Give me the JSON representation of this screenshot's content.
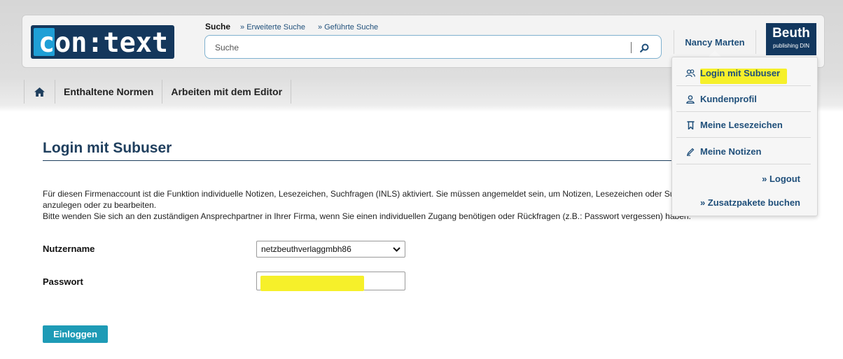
{
  "header": {
    "logo_text": "con:text",
    "search_title": "Suche",
    "search_links": [
      "» Erweiterte Suche",
      "» Geführte Suche"
    ],
    "search_placeholder": "Suche",
    "user_name": "Nancy Marten",
    "publisher_logo": {
      "name": "Beuth",
      "sub": "publishing DIN"
    }
  },
  "nav": {
    "items": [
      "Enthaltene Normen",
      "Arbeiten mit dem Editor"
    ]
  },
  "user_menu": {
    "items": [
      {
        "label": "Login mit Subuser",
        "icon": "users-icon",
        "highlighted": true
      },
      {
        "label": "Kundenprofil",
        "icon": "person-icon"
      },
      {
        "label": "Meine Lesezeichen",
        "icon": "bookmark-icon"
      },
      {
        "label": "Meine Notizen",
        "icon": "pencil-icon"
      }
    ],
    "logout": "» Logout",
    "addons": "» Zusatzpakete buchen"
  },
  "page": {
    "title": "Login mit Subuser",
    "info_line1": "Für diesen Firmenaccount ist die Funktion individuelle Notizen, Lesezeichen, Suchfragen (INLS) aktiviert. Sie müssen angemeldet sein, um Notizen, Lesezeichen oder Suchfragen",
    "info_line2": "anzulegen oder zu bearbeiten.",
    "info_line3": "Bitte wenden Sie sich an den zuständigen Ansprechpartner in Ihrer Firma, wenn Sie einen individuellen Zugang benötigen oder Rückfragen (z.B.: Passwort vergessen) haben."
  },
  "form": {
    "username_label": "Nutzername",
    "username_value": "netzbeuthverlaggmbh86",
    "password_label": "Passwort",
    "submit_label": "Einloggen"
  },
  "colors": {
    "brand_dark": "#12375e",
    "link_blue": "#1f4f7a",
    "button_teal": "#1e9bb6",
    "highlight_yellow": "#f6f02a"
  }
}
